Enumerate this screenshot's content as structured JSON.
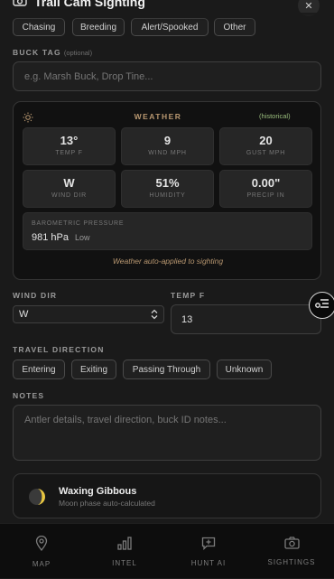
{
  "header": {
    "title": "Trail Cam Sighting",
    "close_glyph": "✕",
    "icon": "camera-icon"
  },
  "behavior_chips": [
    "Chasing",
    "Breeding",
    "Alert/Spooked",
    "Other"
  ],
  "buck_tag": {
    "label": "BUCK TAG",
    "optional": "(optional)",
    "placeholder": "e.g. Marsh Buck, Drop Tine..."
  },
  "weather": {
    "title": "WEATHER",
    "badge": "(historical)",
    "icon": "sun-icon",
    "cells": [
      {
        "value": "13°",
        "label": "TEMP F"
      },
      {
        "value": "9",
        "label": "WIND MPH"
      },
      {
        "value": "20",
        "label": "GUST MPH"
      },
      {
        "value": "W",
        "label": "WIND DIR"
      },
      {
        "value": "51%",
        "label": "HUMIDITY"
      },
      {
        "value": "0.00\"",
        "label": "PRECIP IN"
      }
    ],
    "pressure": {
      "label": "BAROMETRIC PRESSURE",
      "value": "981 hPa",
      "status": "Low"
    },
    "note": "Weather auto-applied to sighting"
  },
  "wind_dir": {
    "label": "WIND DIR",
    "value": "W",
    "icon": "chevron-updown-icon"
  },
  "temp_f": {
    "label": "TEMP F",
    "value": "13"
  },
  "travel_direction": {
    "label": "TRAVEL DIRECTION",
    "options": [
      "Entering",
      "Exiting",
      "Passing Through",
      "Unknown"
    ]
  },
  "notes": {
    "label": "NOTES",
    "placeholder": "Antler details, travel direction, buck ID notes..."
  },
  "moon": {
    "phase": "Waxing Gibbous",
    "subtitle": "Moon phase auto-calculated",
    "illumination": 0.8,
    "icon": "moon-icon"
  },
  "nav": [
    {
      "label": "MAP",
      "icon": "map-pin-icon"
    },
    {
      "label": "INTEL",
      "icon": "bar-chart-icon"
    },
    {
      "label": "HUNT AI",
      "icon": "chat-plus-icon"
    },
    {
      "label": "SIGHTINGS",
      "icon": "camera-icon"
    }
  ],
  "colors": {
    "accent_tan": "#b89770",
    "badge_green": "#9bbf7e",
    "moon_yellow": "#e8c640",
    "background": "#1a1a1a"
  }
}
